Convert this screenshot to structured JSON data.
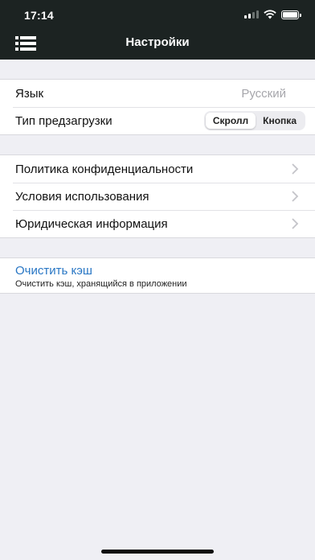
{
  "status_bar": {
    "time": "17:14"
  },
  "nav": {
    "title": "Настройки",
    "menu_icon": "list-menu-icon"
  },
  "settings_group_1": {
    "language": {
      "label": "Язык",
      "value": "Русский"
    },
    "preload": {
      "label": "Тип предзагрузки",
      "options": [
        "Скролл",
        "Кнопка"
      ],
      "selected": "Скролл"
    }
  },
  "settings_group_2": {
    "items": [
      {
        "label": "Политика конфиденциальности"
      },
      {
        "label": "Условия использования"
      },
      {
        "label": "Юридическая информация"
      }
    ]
  },
  "cache": {
    "title": "Очистить кэш",
    "subtitle": "Очистить кэш, хранящийся в приложении"
  },
  "colors": {
    "nav_bg": "#1c2322",
    "link": "#2876c4",
    "background": "#efeff4"
  }
}
